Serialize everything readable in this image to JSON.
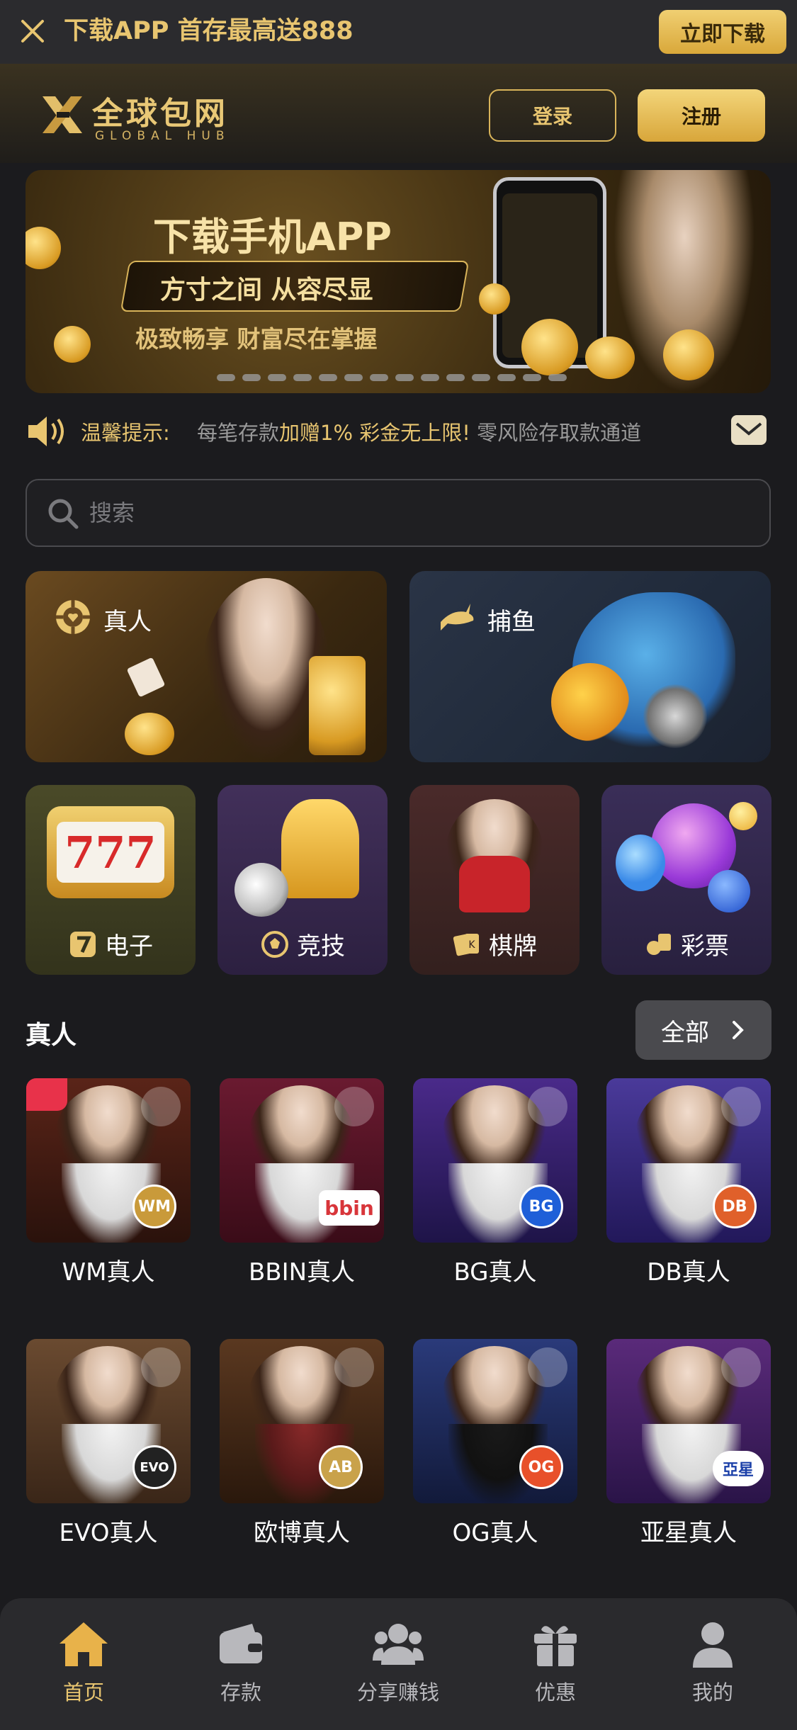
{
  "topbar": {
    "promo": "下载APP 首存最高送888",
    "download_label": "立即下载"
  },
  "header": {
    "logo_cn": "全球包网",
    "logo_en": "GLOBAL HUB",
    "login_label": "登录",
    "register_label": "注册"
  },
  "banner": {
    "title": "下载手机APP",
    "subtitle": "方寸之间 从容尽显",
    "tagline": "极致畅享 财富尽在掌握",
    "slide_count": 14
  },
  "notice": {
    "label": "温馨提示:",
    "text_a": "每笔存款",
    "text_b": "加赠1% 彩金无上限!",
    "text_c": " 零风险存取款通道"
  },
  "search": {
    "placeholder": "搜索"
  },
  "categories": {
    "big": [
      {
        "label": "真人",
        "icon": "chip-icon"
      },
      {
        "label": "捕鱼",
        "icon": "shark-icon"
      }
    ],
    "small": [
      {
        "label": "电子",
        "icon": "seven-icon"
      },
      {
        "label": "竞技",
        "icon": "soccer-ball-icon"
      },
      {
        "label": "棋牌",
        "icon": "cards-icon"
      },
      {
        "label": "彩票",
        "icon": "lottery-icon"
      }
    ]
  },
  "section": {
    "title": "真人",
    "all_label": "全部"
  },
  "providers": [
    {
      "label": "WM真人",
      "badge": "WM",
      "badge_color": "#c99a3a"
    },
    {
      "label": "BBIN真人",
      "badge": "bbin",
      "badge_color": "#d8353a"
    },
    {
      "label": "BG真人",
      "badge": "BG",
      "badge_color": "#1f5fd8"
    },
    {
      "label": "DB真人",
      "badge": "DB",
      "badge_color": "#e0602a"
    },
    {
      "label": "EVO真人",
      "badge": "EVO",
      "badge_color": "#222222"
    },
    {
      "label": "欧博真人",
      "badge": "AB",
      "badge_color": "#c9a24a"
    },
    {
      "label": "OG真人",
      "badge": "OG",
      "badge_color": "#e8502a"
    },
    {
      "label": "亚星真人",
      "badge": "亞星",
      "badge_color": "#1a3fa8"
    }
  ],
  "bottom_nav": [
    {
      "label": "首页",
      "icon": "home-icon",
      "active": true
    },
    {
      "label": "存款",
      "icon": "wallet-icon",
      "active": false
    },
    {
      "label": "分享赚钱",
      "icon": "share-users-icon",
      "active": false
    },
    {
      "label": "优惠",
      "icon": "gift-icon",
      "active": false
    },
    {
      "label": "我的",
      "icon": "profile-icon",
      "active": false
    }
  ],
  "colors": {
    "gold": "#e8c570",
    "background": "#1b1b1e",
    "nav_bg": "#2a2a2d"
  }
}
